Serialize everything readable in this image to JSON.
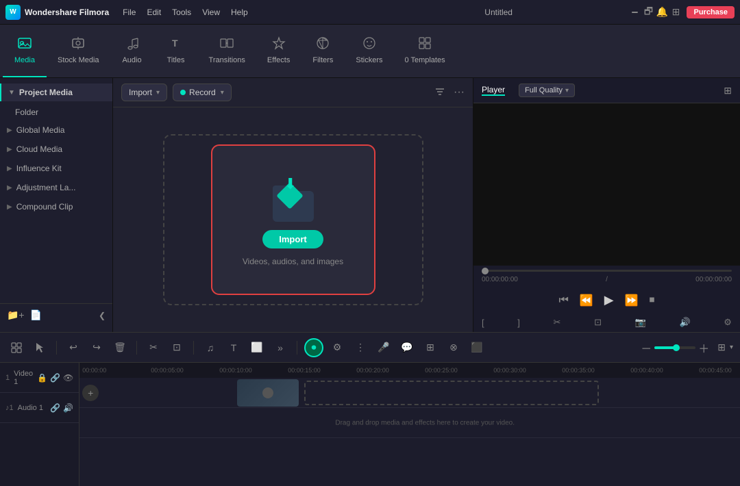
{
  "titlebar": {
    "app_name": "Wondershare Filmora",
    "menus": [
      "File",
      "Edit",
      "Tools",
      "View",
      "Help"
    ],
    "title": "Untitled",
    "purchase_label": "Purchase"
  },
  "toolbar": {
    "tabs": [
      {
        "id": "media",
        "label": "Media",
        "icon": "🎞",
        "active": true
      },
      {
        "id": "stock",
        "label": "Stock Media",
        "icon": "🎵"
      },
      {
        "id": "audio",
        "label": "Audio",
        "icon": "🎵"
      },
      {
        "id": "titles",
        "label": "Titles",
        "icon": "T"
      },
      {
        "id": "transitions",
        "label": "Transitions",
        "icon": "⊞"
      },
      {
        "id": "effects",
        "label": "Effects",
        "icon": "✦"
      },
      {
        "id": "filters",
        "label": "Filters",
        "icon": "⬡"
      },
      {
        "id": "stickers",
        "label": "Stickers",
        "icon": "⊕"
      },
      {
        "id": "templates",
        "label": "Templates",
        "icon": "▦"
      },
      {
        "id": "0 templates_badge",
        "label": "0 Templates",
        "icon": ""
      }
    ]
  },
  "sidebar": {
    "project_media": "Project Media",
    "folder_label": "Folder",
    "items": [
      {
        "id": "global",
        "label": "Global Media"
      },
      {
        "id": "cloud",
        "label": "Cloud Media"
      },
      {
        "id": "influence",
        "label": "Influence Kit"
      },
      {
        "id": "adjustment",
        "label": "Adjustment La..."
      },
      {
        "id": "compound",
        "label": "Compound Clip"
      }
    ]
  },
  "content": {
    "import_label": "Import",
    "record_label": "Record",
    "dropzone": {
      "import_btn_label": "Import",
      "hint_text": "Videos, audios, and images"
    }
  },
  "player": {
    "tab_label": "Player",
    "quality_label": "Full Quality",
    "time_current": "00:00:00:00",
    "time_total": "00:00:00:00"
  },
  "timeline": {
    "tracks": [
      {
        "id": "video1",
        "label": "Video 1"
      },
      {
        "id": "audio1",
        "label": "Audio 1"
      }
    ],
    "drag_hint": "Drag and drop media and effects here to create your video.",
    "ruler_marks": [
      "00:00:00",
      "00:00:05:00",
      "00:00:10:00",
      "00:00:15:00",
      "00:00:20:00",
      "00:00:25:00",
      "00:00:30:00",
      "00:00:35:00",
      "00:00:40:00",
      "00:00:45:00"
    ]
  }
}
